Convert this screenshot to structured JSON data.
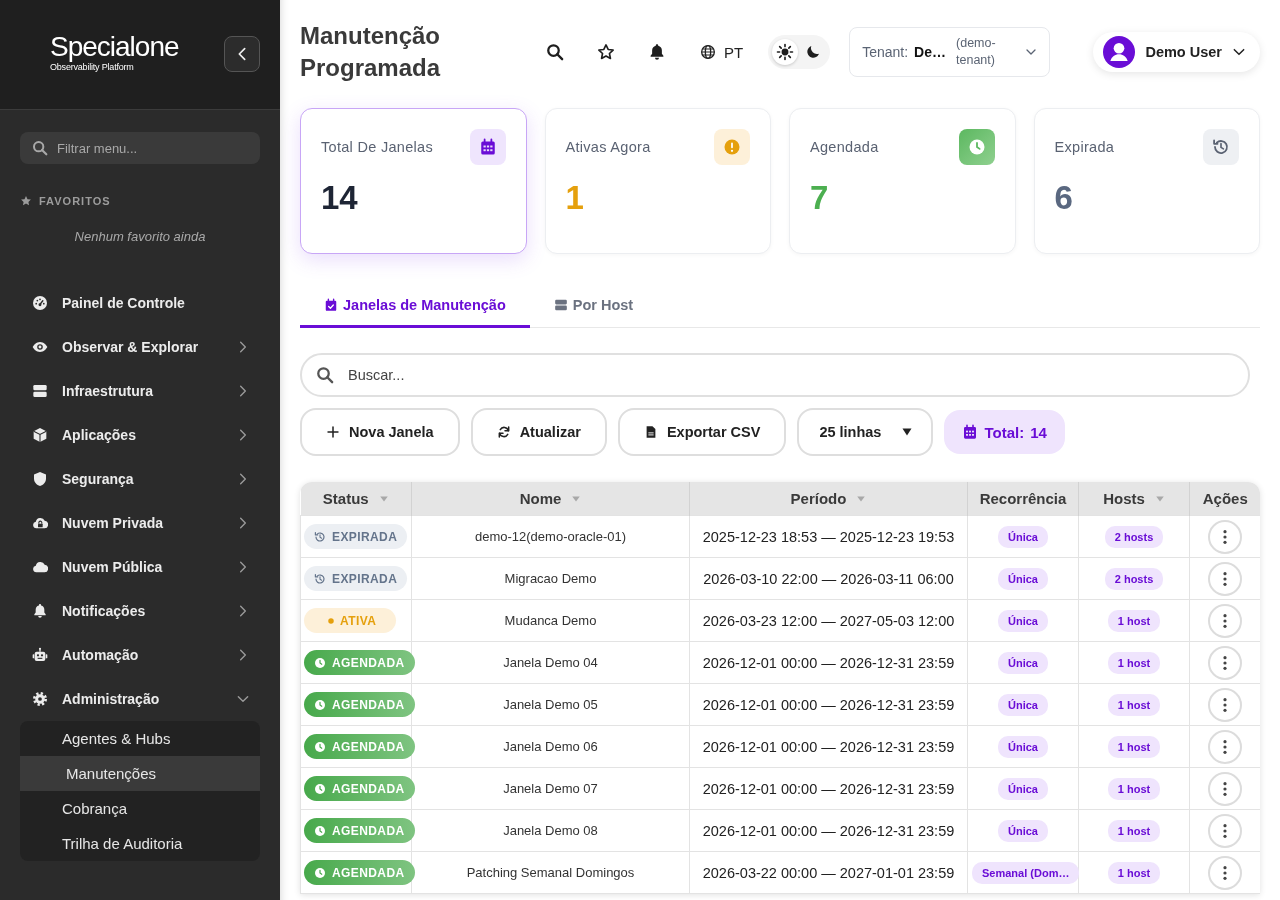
{
  "sidebar": {
    "logo": {
      "name": "Specialone",
      "tagline": "Observability Platform"
    },
    "filter": {
      "placeholder": "Filtrar menu..."
    },
    "favorites": {
      "title": "FAVORITOS",
      "empty": "Nenhum favorito ainda"
    },
    "items": [
      {
        "label": "Painel de Controle",
        "kind": "link"
      },
      {
        "label": "Observar & Explorar",
        "kind": "group",
        "expanded": false
      },
      {
        "label": "Infraestrutura",
        "kind": "group",
        "expanded": false
      },
      {
        "label": "Aplicações",
        "kind": "group",
        "expanded": false
      },
      {
        "label": "Segurança",
        "kind": "group",
        "expanded": false
      },
      {
        "label": "Nuvem Privada",
        "kind": "group",
        "expanded": false
      },
      {
        "label": "Nuvem Pública",
        "kind": "group",
        "expanded": false
      },
      {
        "label": "Notificações",
        "kind": "group",
        "expanded": false
      },
      {
        "label": "Automação",
        "kind": "group",
        "expanded": false
      },
      {
        "label": "Administração",
        "kind": "group",
        "expanded": true,
        "children": [
          {
            "label": "Agentes & Hubs",
            "selected": false
          },
          {
            "label": "Manutenções",
            "selected": true
          },
          {
            "label": "Cobrança",
            "selected": false
          },
          {
            "label": "Trilha de Auditoria",
            "selected": false
          }
        ]
      }
    ]
  },
  "header": {
    "title": "Manutenção Programada",
    "language": "PT",
    "theme": {
      "dark": false
    },
    "tenant": {
      "label": "Tenant:",
      "value": "De…",
      "note": "(demo-tenant)"
    },
    "user": {
      "name": "Demo User"
    }
  },
  "stats": [
    {
      "label": "Total De Janelas",
      "value": "14",
      "kind": "total",
      "selected": true
    },
    {
      "label": "Ativas Agora",
      "value": "1",
      "kind": "active",
      "selected": false
    },
    {
      "label": "Agendada",
      "value": "7",
      "kind": "scheduled",
      "selected": false
    },
    {
      "label": "Expirada",
      "value": "6",
      "kind": "expired",
      "selected": false
    }
  ],
  "tabs": [
    {
      "label": "Janelas de Manutenção",
      "selected": true
    },
    {
      "label": "Por Host",
      "selected": false
    }
  ],
  "search": {
    "placeholder": "Buscar..."
  },
  "toolbar": {
    "buttons": [
      "Nova Janela",
      "Atualizar",
      "Exportar CSV"
    ],
    "page_size": "25 linhas",
    "total": {
      "label": "Total:",
      "value": "14"
    }
  },
  "table": {
    "columns": [
      {
        "label": "Status",
        "sortable": true
      },
      {
        "label": "Nome",
        "sortable": true
      },
      {
        "label": "Período",
        "sortable": true
      },
      {
        "label": "Recorrência",
        "sortable": false
      },
      {
        "label": "Hosts",
        "sortable": true
      },
      {
        "label": "Ações",
        "sortable": false
      }
    ],
    "rows": [
      {
        "status": {
          "kind": "expired",
          "label": "EXPIRADA"
        },
        "name": "demo-12(demo-oracle-01)",
        "period": "2025-12-23 18:53 — 2025-12-23 19:53",
        "recurrence": "Única",
        "hosts": "2 hosts"
      },
      {
        "status": {
          "kind": "expired",
          "label": "EXPIRADA"
        },
        "name": "Migracao Demo",
        "period": "2026-03-10 22:00 — 2026-03-11 06:00",
        "recurrence": "Única",
        "hosts": "2 hosts"
      },
      {
        "status": {
          "kind": "active",
          "label": "ATIVA"
        },
        "name": "Mudanca Demo",
        "period": "2026-03-23 12:00 — 2027-05-03 12:00",
        "recurrence": "Única",
        "hosts": "1 host"
      },
      {
        "status": {
          "kind": "scheduled",
          "label": "AGENDADA"
        },
        "name": "Janela Demo 04",
        "period": "2026-12-01 00:00 — 2026-12-31 23:59",
        "recurrence": "Única",
        "hosts": "1 host"
      },
      {
        "status": {
          "kind": "scheduled",
          "label": "AGENDADA"
        },
        "name": "Janela Demo 05",
        "period": "2026-12-01 00:00 — 2026-12-31 23:59",
        "recurrence": "Única",
        "hosts": "1 host"
      },
      {
        "status": {
          "kind": "scheduled",
          "label": "AGENDADA"
        },
        "name": "Janela Demo 06",
        "period": "2026-12-01 00:00 — 2026-12-31 23:59",
        "recurrence": "Única",
        "hosts": "1 host"
      },
      {
        "status": {
          "kind": "scheduled",
          "label": "AGENDADA"
        },
        "name": "Janela Demo 07",
        "period": "2026-12-01 00:00 — 2026-12-31 23:59",
        "recurrence": "Única",
        "hosts": "1 host"
      },
      {
        "status": {
          "kind": "scheduled",
          "label": "AGENDADA"
        },
        "name": "Janela Demo 08",
        "period": "2026-12-01 00:00 — 2026-12-31 23:59",
        "recurrence": "Única",
        "hosts": "1 host"
      },
      {
        "status": {
          "kind": "scheduled",
          "label": "AGENDADA"
        },
        "name": "Patching Semanal Domingos",
        "period": "2026-03-22 00:00 — 2027-01-01 23:59",
        "recurrence": "Semanal (Dom…",
        "hosts": "1 host"
      }
    ]
  }
}
